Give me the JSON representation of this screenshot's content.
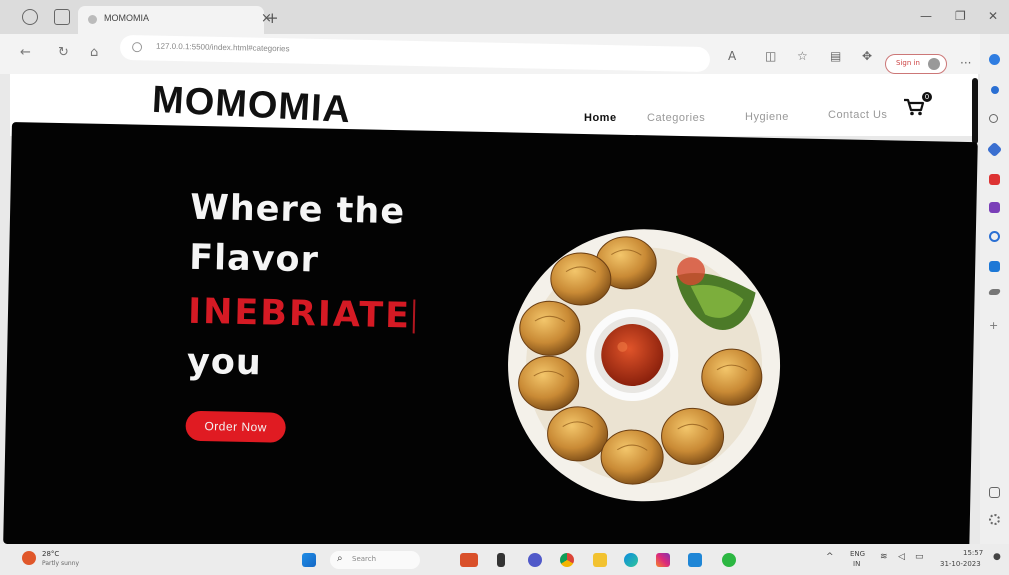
{
  "browser": {
    "tab_title": "MOMOMIA",
    "tab_close": "×",
    "new_tab": "+",
    "url": "127.0.0.1:5500/index.html#categories",
    "signin_label": "Sign in"
  },
  "site": {
    "logo": "MOMOMIA",
    "nav": [
      "Home",
      "Categories",
      "Hygiene",
      "Contact Us"
    ],
    "cart_count": "0"
  },
  "hero": {
    "line1": "Where the",
    "line2": "Flavor",
    "highlight": "INEBRIATE",
    "line4": "you",
    "cta": "Order Now"
  },
  "taskbar": {
    "temperature": "28°C",
    "condition": "Partly sunny",
    "search_placeholder": "Search",
    "lang_top": "ENG",
    "lang_bottom": "IN",
    "time": "15:57",
    "date": "31-10-2023"
  },
  "colors": {
    "hero_bg": "#030303",
    "accent_red": "#e01b22"
  }
}
